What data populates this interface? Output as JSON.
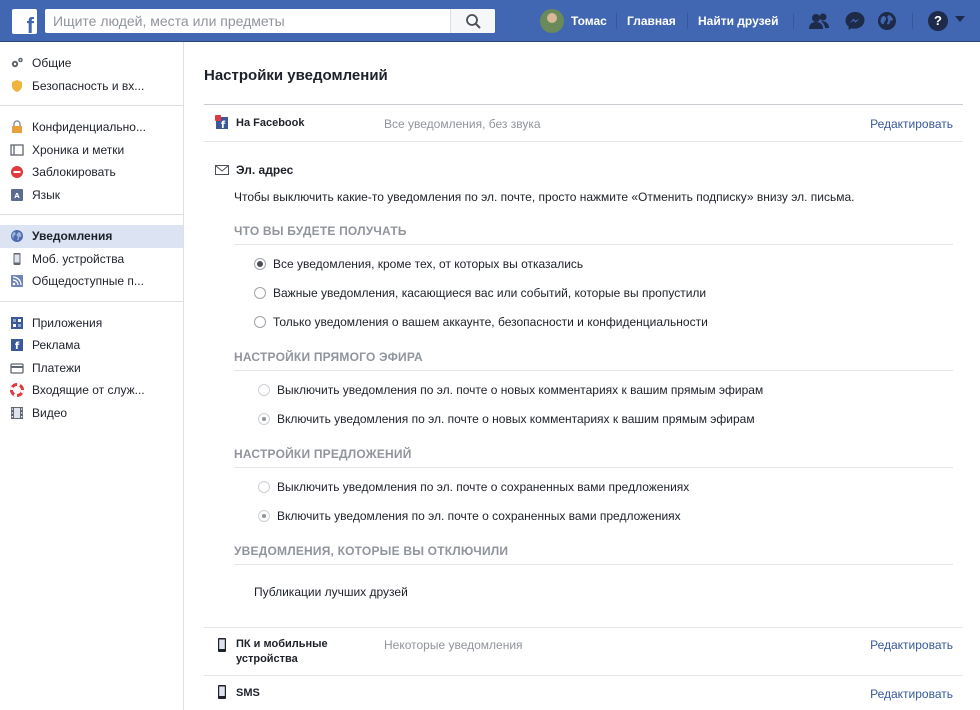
{
  "topbar": {
    "logo": "f",
    "search_placeholder": "Ищите людей, места или предметы",
    "user_name": "Томас",
    "home": "Главная",
    "find_friends": "Найти друзей",
    "help": "?",
    "accent_color": "#4267b2"
  },
  "sidebar": {
    "groups": [
      [
        {
          "label": "Общие",
          "icon": "gears-icon"
        },
        {
          "label": "Безопасность и вх...",
          "icon": "shield-icon"
        }
      ],
      [
        {
          "label": "Конфиденциально...",
          "icon": "lock-icon"
        },
        {
          "label": "Хроника и метки",
          "icon": "timeline-icon"
        },
        {
          "label": "Заблокировать",
          "icon": "block-icon"
        },
        {
          "label": "Язык",
          "icon": "language-icon"
        }
      ],
      [
        {
          "label": "Уведомления",
          "icon": "globe-icon",
          "active": true
        },
        {
          "label": "Моб. устройства",
          "icon": "phone-icon"
        },
        {
          "label": "Общедоступные п...",
          "icon": "rss-icon"
        }
      ],
      [
        {
          "label": "Приложения",
          "icon": "apps-icon"
        },
        {
          "label": "Реклама",
          "icon": "ads-icon"
        },
        {
          "label": "Платежи",
          "icon": "card-icon"
        },
        {
          "label": "Входящие от служ...",
          "icon": "lifebuoy-icon"
        },
        {
          "label": "Видео",
          "icon": "film-icon"
        }
      ]
    ]
  },
  "main": {
    "title": "Настройки уведомлений",
    "facebook_row": {
      "label": "На Facebook",
      "value": "Все уведомления, без звука",
      "edit": "Редактировать"
    },
    "email": {
      "title": "Эл. адрес",
      "description": "Чтобы выключить какие-то уведомления по эл. почте, просто нажмите «Отменить подписку» внизу эл. письма.",
      "receive_head": "ЧТО ВЫ БУДЕТЕ ПОЛУЧАТЬ",
      "receive_options": [
        {
          "label": "Все уведомления, кроме тех, от которых вы отказались",
          "checked": true
        },
        {
          "label": "Важные уведомления, касающиеся вас или событий, которые вы пропустили",
          "checked": false
        },
        {
          "label": "Только уведомления о вашем аккаунте, безопасности и конфиденциальности",
          "checked": false
        }
      ],
      "live_head": "НАСТРОЙКИ ПРЯМОГО ЭФИРА",
      "live_options": [
        {
          "label": "Выключить уведомления по эл. почте о новых комментариях к вашим прямым эфирам",
          "checked": false
        },
        {
          "label": "Включить уведомления по эл. почте о новых комментариях к вашим прямым эфирам",
          "checked": true
        }
      ],
      "offers_head": "НАСТРОЙКИ ПРЕДЛОЖЕНИЙ",
      "offers_options": [
        {
          "label": "Выключить уведомления по эл. почте о сохраненных вами предложениях",
          "checked": false
        },
        {
          "label": "Включить уведомления по эл. почте о сохраненных вами предложениях",
          "checked": true
        }
      ],
      "disabled_head": "УВЕДОМЛЕНИЯ, КОТОРЫЕ ВЫ ОТКЛЮЧИЛИ",
      "disabled_item": "Публикации лучших друзей"
    },
    "devices_row": {
      "label_line1": "ПК и мобильные",
      "label_line2": "устройства",
      "value": "Некоторые уведомления",
      "edit": "Редактировать"
    },
    "sms_row": {
      "label": "SMS",
      "edit": "Редактировать"
    }
  }
}
